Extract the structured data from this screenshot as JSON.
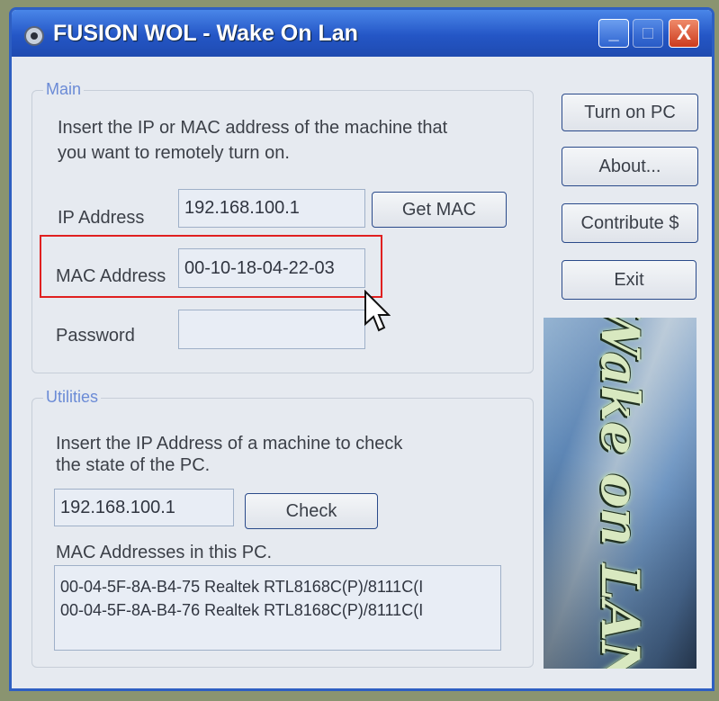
{
  "window": {
    "title": "FUSION WOL - Wake On Lan",
    "minimize_glyph": "_",
    "maximize_glyph": "□",
    "close_glyph": "X"
  },
  "main": {
    "group_label": "Main",
    "instructions_line1": "Insert the IP or MAC address of the machine that",
    "instructions_line2": "you want to remotely turn on.",
    "ip_label": "IP Address",
    "ip_value": "192.168.100.1",
    "get_mac_label": "Get MAC",
    "mac_label": "MAC Address",
    "mac_value": "00-10-18-04-22-03",
    "password_label": "Password",
    "password_value": ""
  },
  "utilities": {
    "group_label": "Utilities",
    "instructions_line1": "Insert the IP Address of a machine to check",
    "instructions_line2": "the state of the PC.",
    "ip_value": "192.168.100.1",
    "check_label": "Check",
    "mac_list_label": "MAC Addresses in this PC.",
    "mac_list": [
      "00-04-5F-8A-B4-75  Realtek RTL8168C(P)/8111C(I",
      "00-04-5F-8A-B4-76  Realtek RTL8168C(P)/8111C(I"
    ]
  },
  "side_buttons": {
    "turn_on": "Turn on PC",
    "about": "About...",
    "contribute": "Contribute $",
    "exit": "Exit"
  },
  "banner": {
    "text": "Wake on LAN"
  },
  "colors": {
    "titlebar": "#2456c6",
    "highlight": "#e02020",
    "group_label": "#6b8bd6"
  }
}
